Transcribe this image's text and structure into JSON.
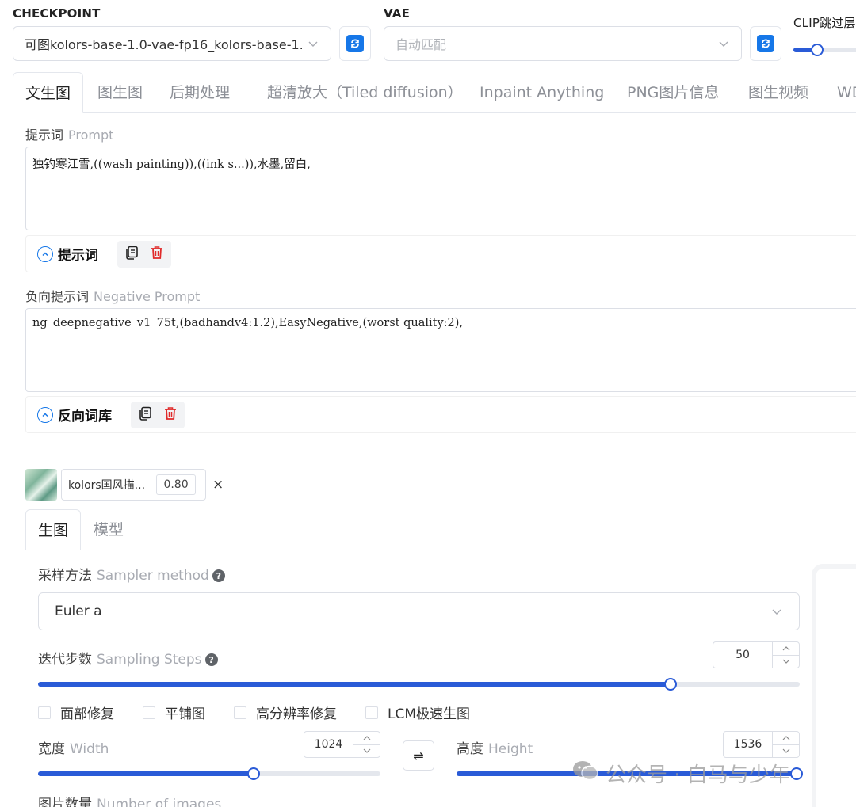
{
  "top": {
    "checkpoint_label": "CHECKPOINT",
    "checkpoint_value": "可图kolors-base-1.0-vae-fp16_kolors-base-1.",
    "vae_label": "VAE",
    "vae_placeholder": "自动匹配",
    "clip_label": "CLIP跳过层"
  },
  "tabs": [
    {
      "label": "文生图"
    },
    {
      "label": "图生图"
    },
    {
      "label": "后期处理"
    },
    {
      "label": "超清放大（Tiled diffusion）"
    },
    {
      "label": "Inpaint Anything"
    },
    {
      "label": "PNG图片信息"
    },
    {
      "label": "图生视频"
    },
    {
      "label": "WD"
    }
  ],
  "prompt": {
    "label": "提示词",
    "label_en": "Prompt",
    "value": "独钓寒江雪,((wash painting)),((ink s...)),水墨,留白,",
    "toolbar_title": "提示词"
  },
  "negative": {
    "label": "负向提示词",
    "label_en": "Negative Prompt",
    "value": "ng_deepnegative_v1_75t,(badhandv4:1.2),EasyNegative,(worst quality:2),",
    "toolbar_title": "反向词库"
  },
  "lora": {
    "name": "kolors国风描...",
    "weight": "0.80",
    "remove": "×"
  },
  "subtabs": [
    {
      "label": "生图"
    },
    {
      "label": "模型"
    }
  ],
  "sampler": {
    "label": "采样方法",
    "label_en": "Sampler method",
    "value": "Euler a"
  },
  "steps": {
    "label": "迭代步数",
    "label_en": "Sampling Steps",
    "value": "50",
    "fraction": 0.83
  },
  "checkboxes": [
    {
      "label": "面部修复"
    },
    {
      "label": "平铺图"
    },
    {
      "label": "高分辨率修复"
    },
    {
      "label": "LCM极速生图"
    }
  ],
  "width": {
    "label": "宽度",
    "label_en": "Width",
    "value": "1024",
    "fraction": 0.63
  },
  "height": {
    "label": "高度",
    "label_en": "Height",
    "value": "1536",
    "fraction": 0.99
  },
  "swap": "⇌",
  "images": {
    "label": "图片数量",
    "label_en": "Number of images"
  },
  "watermark": "公众号 · 白马与少年",
  "colors": {
    "accent": "#2a5bd7",
    "refresh": "#1677e8",
    "delete": "#e02a2a"
  }
}
